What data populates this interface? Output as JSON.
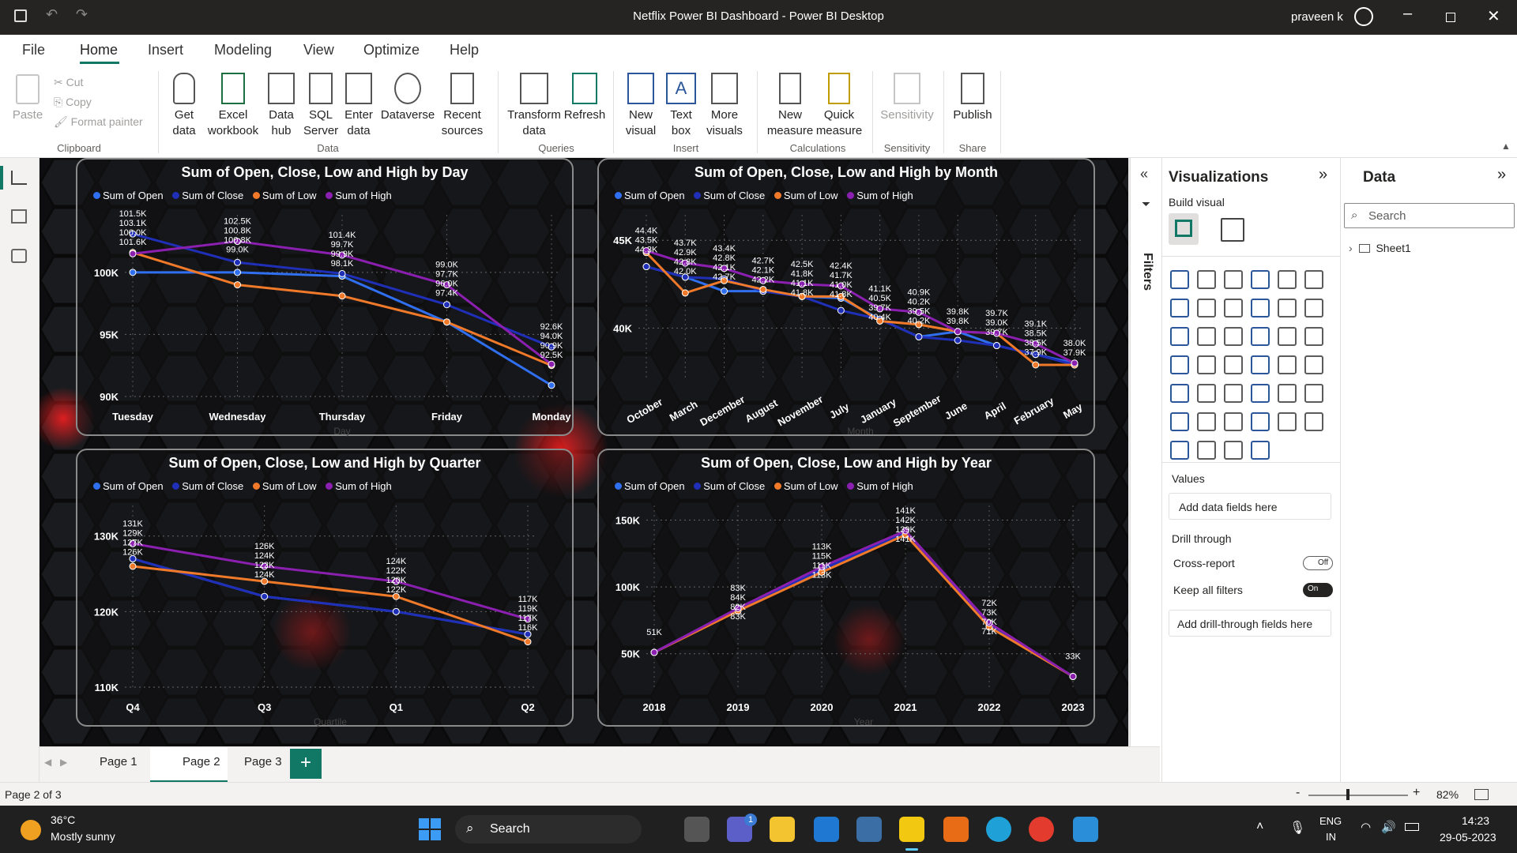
{
  "window": {
    "title": "Netflix Power BI Dashboard - Power BI Desktop",
    "user": "praveen k"
  },
  "menu": [
    "File",
    "Home",
    "Insert",
    "Modeling",
    "View",
    "Optimize",
    "Help"
  ],
  "ribbon": {
    "clipboard": {
      "paste": "Paste",
      "cut": "Cut",
      "copy": "Copy",
      "format_painter": "Format painter",
      "group": "Clipboard"
    },
    "data": {
      "get_data": "Get data",
      "excel": "Excel workbook",
      "hub": "Data hub",
      "sql": "SQL Server",
      "enter": "Enter data",
      "dataverse": "Dataverse",
      "recent": "Recent sources",
      "group": "Data"
    },
    "queries": {
      "transform": "Transform data",
      "refresh": "Refresh",
      "group": "Queries"
    },
    "insert": {
      "new_visual": "New visual",
      "text_box": "Text box",
      "more": "More visuals",
      "group": "Insert"
    },
    "calc": {
      "new_measure": "New measure",
      "quick_measure": "Quick measure",
      "group": "Calculations"
    },
    "sensitivity": {
      "label": "Sensitivity",
      "group": "Sensitivity"
    },
    "share": {
      "publish": "Publish",
      "group": "Share"
    }
  },
  "legend": [
    "Sum of Open",
    "Sum of Close",
    "Sum of Low",
    "Sum of High"
  ],
  "colors": {
    "open": "#2f6ff0",
    "close": "#1f2fb8",
    "low": "#f07a2a",
    "high": "#8a1fb0"
  },
  "chart_data": [
    {
      "type": "line",
      "title": "Sum of Open, Close, Low and High by Day",
      "xlabel": "Day",
      "categories": [
        "Tuesday",
        "Wednesday",
        "Thursday",
        "Friday",
        "Monday"
      ],
      "ylim": [
        90000,
        104000
      ],
      "yticks": [
        "90K",
        "95K",
        "100K"
      ],
      "series": [
        {
          "name": "Sum of Open",
          "values": [
            100000,
            100000,
            99700,
            96000,
            90900
          ]
        },
        {
          "name": "Sum of Close",
          "values": [
            103100,
            100800,
            99900,
            97400,
            94000
          ]
        },
        {
          "name": "Sum of Low",
          "values": [
            101600,
            99000,
            98100,
            96000,
            92500
          ]
        },
        {
          "name": "Sum of High",
          "values": [
            101500,
            102500,
            101400,
            99000,
            92600
          ]
        }
      ],
      "labels": [
        [
          "101.5K",
          "103.1K",
          "100.0K",
          "101.6K"
        ],
        [
          "102.5K",
          "100.8K",
          "100.8K",
          "99.0K"
        ],
        [
          "101.4K",
          "99.7K",
          "99.9K",
          "98.1K"
        ],
        [
          "99.0K",
          "97.7K",
          "96.0K",
          "97.4K"
        ],
        [
          "92.6K",
          "94.0K",
          "90.9K",
          "92.5K"
        ]
      ]
    },
    {
      "type": "line",
      "title": "Sum of Open, Close, Low and High by Month",
      "xlabel": "Month",
      "categories": [
        "October",
        "March",
        "December",
        "August",
        "November",
        "July",
        "January",
        "September",
        "June",
        "April",
        "February",
        "May"
      ],
      "ylim": [
        37000,
        46000
      ],
      "yticks": [
        "40K",
        "45K"
      ],
      "series": [
        {
          "name": "Sum of Open",
          "values": [
            43500,
            42900,
            42100,
            42100,
            41800,
            41700,
            40500,
            39500,
            39800,
            39000,
            38500,
            38000
          ]
        },
        {
          "name": "Sum of Close",
          "values": [
            43500,
            42900,
            42800,
            42100,
            41800,
            41000,
            40500,
            39500,
            39300,
            39000,
            38500,
            37900
          ]
        },
        {
          "name": "Sum of Low",
          "values": [
            44300,
            42000,
            42700,
            42200,
            41800,
            41800,
            40400,
            40200,
            39800,
            39700,
            37900,
            37900
          ]
        },
        {
          "name": "Sum of High",
          "values": [
            44400,
            43700,
            43400,
            42700,
            42500,
            42400,
            41100,
            40900,
            39800,
            39700,
            39100,
            38000
          ]
        }
      ],
      "labels": [
        [
          "44.4K",
          "43.5K",
          "44.3K"
        ],
        [
          "43.7K",
          "42.9K",
          "42.8K",
          "42.0K"
        ],
        [
          "43.4K",
          "42.8K",
          "42.1K",
          "42.7K"
        ],
        [
          "42.7K",
          "42.1K",
          "42.2K"
        ],
        [
          "42.5K",
          "41.8K",
          "41.1K",
          "41.8K"
        ],
        [
          "42.4K",
          "41.7K",
          "41.0K",
          "41.8K"
        ],
        [
          "41.1K",
          "40.5K",
          "39.7K",
          "40.4K"
        ],
        [
          "40.9K",
          "40.2K",
          "39.5K",
          "40.2K"
        ],
        [
          "39.8K",
          "39.8K"
        ],
        [
          "39.7K",
          "39.0K",
          "39.7K"
        ],
        [
          "39.1K",
          "38.5K",
          "38.5K",
          "37.9K"
        ],
        [
          "38.0K",
          "37.9K"
        ]
      ]
    },
    {
      "type": "line",
      "title": "Sum of Open, Close, Low and High by Quarter",
      "xlabel": "Quartile",
      "categories": [
        "Q4",
        "Q3",
        "Q1",
        "Q2"
      ],
      "ylim": [
        110000,
        133000
      ],
      "yticks": [
        "110K",
        "120K",
        "130K"
      ],
      "series": [
        {
          "name": "Sum of Open",
          "values": [
            127000,
            122000,
            120000,
            117000
          ]
        },
        {
          "name": "Sum of Close",
          "values": [
            127000,
            122000,
            120000,
            117000
          ]
        },
        {
          "name": "Sum of Low",
          "values": [
            126000,
            124000,
            122000,
            116000
          ]
        },
        {
          "name": "Sum of High",
          "values": [
            129000,
            126000,
            124000,
            119000
          ]
        }
      ],
      "labels": [
        [
          "131K",
          "129K",
          "127K",
          "126K"
        ],
        [
          "126K",
          "124K",
          "122K",
          "124K"
        ],
        [
          "124K",
          "122K",
          "120K",
          "122K"
        ],
        [
          "117K",
          "119K",
          "117K",
          "116K"
        ]
      ]
    },
    {
      "type": "line",
      "title": "Sum of Open, Close, Low and High by Year",
      "xlabel": "Year",
      "categories": [
        "2018",
        "2019",
        "2020",
        "2021",
        "2022",
        "2023"
      ],
      "ylim": [
        25000,
        155000
      ],
      "yticks": [
        "50K",
        "100K",
        "150K"
      ],
      "series": [
        {
          "name": "Sum of Open",
          "values": [
            51000,
            83000,
            113000,
            141000,
            71000,
            33000
          ]
        },
        {
          "name": "Sum of Close",
          "values": [
            51000,
            83000,
            113000,
            141000,
            71000,
            33000
          ]
        },
        {
          "name": "Sum of Low",
          "values": [
            51000,
            82000,
            111000,
            139000,
            70000,
            33000
          ]
        },
        {
          "name": "Sum of High",
          "values": [
            51000,
            84000,
            115000,
            142000,
            73000,
            33000
          ]
        }
      ],
      "labels": [
        [
          "51K"
        ],
        [
          "83K",
          "84K",
          "82K",
          "83K"
        ],
        [
          "113K",
          "115K",
          "111K",
          "113K"
        ],
        [
          "141K",
          "142K",
          "139K",
          "141K"
        ],
        [
          "72K",
          "73K",
          "70K",
          "71K"
        ],
        [
          "33K"
        ]
      ]
    }
  ],
  "filters": {
    "label": "Filters"
  },
  "viz": {
    "title": "Visualizations",
    "build": "Build visual",
    "values": "Values",
    "add_data": "Add data fields here",
    "drill": "Drill through",
    "cross": "Cross-report",
    "cross_state": "Off",
    "keep": "Keep all filters",
    "keep_state": "On",
    "add_drill": "Add drill-through fields here"
  },
  "data_pane": {
    "title": "Data",
    "search_placeholder": "Search",
    "table": "Sheet1"
  },
  "pages": [
    "Page 1",
    "Page 2",
    "Page 3"
  ],
  "status": {
    "page": "Page 2 of 3",
    "zoom": "82%"
  },
  "taskbar": {
    "temp": "36°C",
    "weather": "Mostly sunny",
    "search": "Search",
    "lang1": "ENG",
    "lang2": "IN",
    "time": "14:23",
    "date": "29-05-2023",
    "badge": "1"
  }
}
